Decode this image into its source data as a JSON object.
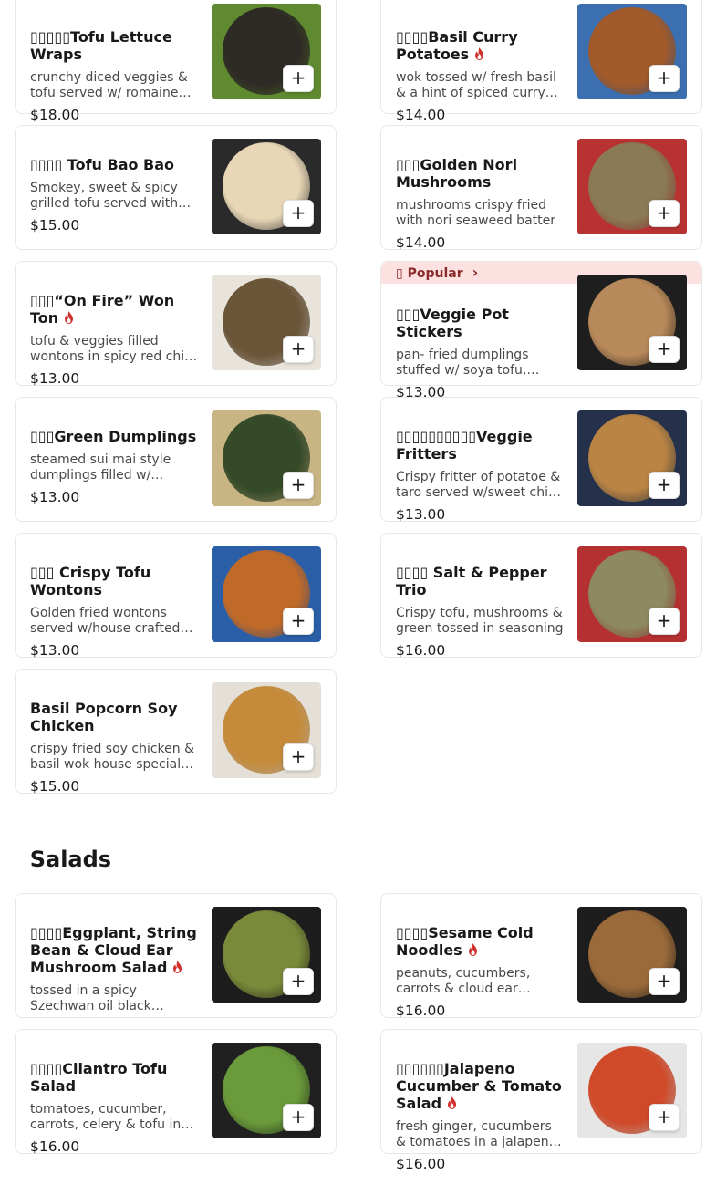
{
  "section_title": "  Salads",
  "add_label": "+",
  "popular_label": "Popular",
  "items": [
    {
      "name": "▯▯▯▯▯Tofu Lettuce Wraps",
      "desc": "crunchy diced veggies & tofu served w/ romaine lettuce cups",
      "price": "$18.00",
      "spicy": false
    },
    {
      "name": "▯▯▯▯Basil Curry Potatoes",
      "desc": "wok tossed w/ fresh basil & a hint of spiced curry sauce",
      "price": "$14.00",
      "spicy": true
    },
    {
      "name": "▯▯▯▯ Tofu Bao Bao",
      "desc": "Smokey, sweet & spicy grilled tofu served with steamed buns",
      "price": "$15.00",
      "spicy": false
    },
    {
      "name": "▯▯▯Golden Nori Mushrooms",
      "desc": "mushrooms crispy fried with nori seaweed batter",
      "price": "$14.00",
      "spicy": false
    },
    {
      "name": "▯▯▯“On Fire” Won Ton",
      "desc": "tofu & veggies filled wontons in spicy red chili oil",
      "price": "$13.00",
      "spicy": true
    },
    {
      "name": "▯▯▯Veggie Pot Stickers",
      "desc": "pan- fried dumplings stuffed w/ soya tofu, veggies",
      "price": "$13.00",
      "spicy": false
    },
    {
      "name": "▯▯▯Green Dumplings",
      "desc": "steamed sui mai style dumplings filled w/ spinach",
      "price": "$13.00",
      "spicy": false
    },
    {
      "name": "▯▯▯▯▯▯▯▯▯▯Veggie Fritters",
      "desc": "Crispy fritter of potatoe & taro served w/sweet chili sauce",
      "price": "$13.00",
      "spicy": false
    },
    {
      "name": "▯▯▯ Crispy Tofu Wontons",
      "desc": "Golden fried wontons served w/house crafted sauce",
      "price": "$13.00",
      "spicy": false
    },
    {
      "name": "▯▯▯▯ Salt & Pepper Trio",
      "desc": "Crispy tofu, mushrooms & green tossed in seasoning",
      "price": "$16.00",
      "spicy": false
    },
    {
      "name": "Basil Popcorn Soy Chicken",
      "desc": "crispy fried soy chicken & basil wok house special seasoning",
      "price": "$15.00",
      "spicy": false
    },
    {
      "name": "▯▯▯▯Eggplant, String Bean & Cloud Ear Mushroom Salad",
      "desc": "tossed in a spicy Szechwan oil black vinegar dressing",
      "price": "",
      "spicy": true
    },
    {
      "name": "▯▯▯▯Sesame Cold Noodles",
      "desc": "peanuts, cucumbers, carrots & cloud ear mushrooms",
      "price": "$16.00",
      "spicy": true
    },
    {
      "name": "▯▯▯▯Cilantro Tofu Salad",
      "desc": "tomatoes, cucumber, carrots, celery & tofu in dressing",
      "price": "$16.00",
      "spicy": false
    },
    {
      "name": "▯▯▯▯▯▯Jalapeno Cucumber & Tomato Salad",
      "desc": "fresh ginger, cucumbers & tomatoes in a jalapeno dressing",
      "price": "$16.00",
      "spicy": true
    }
  ],
  "colors": {
    "spicy": "#d0312d",
    "popular_band": "#fde0e0",
    "card_border": "#e8e8e8"
  },
  "icons": {
    "fire": "fire-icon",
    "popular": "popular-icon",
    "chevron": "chevron-right-icon",
    "add": "plus-icon"
  }
}
